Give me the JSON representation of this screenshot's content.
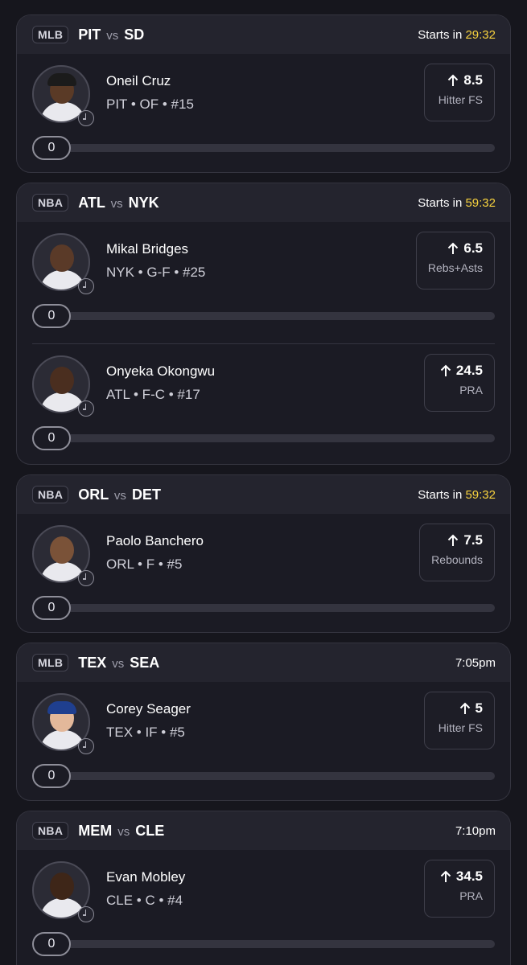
{
  "games": [
    {
      "league": "MLB",
      "team1": "PIT",
      "vs": "vs",
      "team2": "SD",
      "time_prefix": "Starts in ",
      "time_value": "29:32",
      "players": [
        {
          "name": "Oneil Cruz",
          "meta": "PIT • OF • #15",
          "line": "8.5",
          "stat": "Hitter FS",
          "progress": "0",
          "cap_color": "#1b1b1b",
          "skin": "#5a3a26"
        }
      ]
    },
    {
      "league": "NBA",
      "team1": "ATL",
      "vs": "vs",
      "team2": "NYK",
      "time_prefix": "Starts in ",
      "time_value": "59:32",
      "players": [
        {
          "name": "Mikal Bridges",
          "meta": "NYK • G-F • #25",
          "line": "6.5",
          "stat": "Rebs+Asts",
          "progress": "0",
          "cap_color": "",
          "skin": "#5a3a28"
        },
        {
          "name": "Onyeka Okongwu",
          "meta": "ATL • F-C • #17",
          "line": "24.5",
          "stat": "PRA",
          "progress": "0",
          "cap_color": "",
          "skin": "#4a2e1f"
        }
      ]
    },
    {
      "league": "NBA",
      "team1": "ORL",
      "vs": "vs",
      "team2": "DET",
      "time_prefix": "Starts in ",
      "time_value": "59:32",
      "players": [
        {
          "name": "Paolo Banchero",
          "meta": "ORL • F • #5",
          "line": "7.5",
          "stat": "Rebounds",
          "progress": "0",
          "cap_color": "",
          "skin": "#7a5238"
        }
      ]
    },
    {
      "league": "MLB",
      "team1": "TEX",
      "vs": "vs",
      "team2": "SEA",
      "time_prefix": "",
      "time_value": "7:05pm",
      "players": [
        {
          "name": "Corey Seager",
          "meta": "TEX • IF • #5",
          "line": "5",
          "stat": "Hitter FS",
          "progress": "0",
          "cap_color": "#1f3f8f",
          "skin": "#e3b89a"
        }
      ]
    },
    {
      "league": "NBA",
      "team1": "MEM",
      "vs": "vs",
      "team2": "CLE",
      "time_prefix": "",
      "time_value": "7:10pm",
      "players": [
        {
          "name": "Evan Mobley",
          "meta": "CLE • C • #4",
          "line": "34.5",
          "stat": "PRA",
          "progress": "0",
          "cap_color": "",
          "skin": "#3e2618"
        }
      ]
    }
  ]
}
